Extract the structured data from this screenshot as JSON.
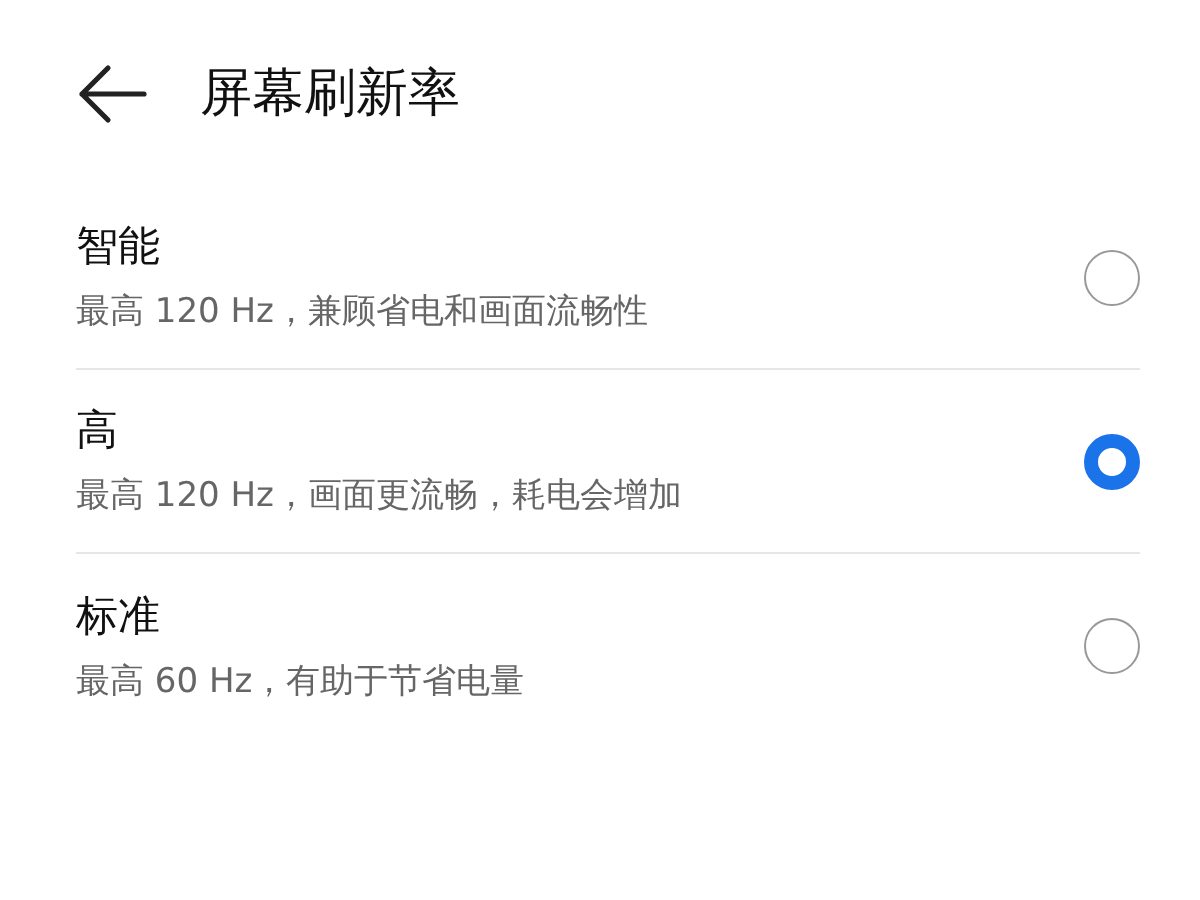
{
  "header": {
    "title": "屏幕刷新率"
  },
  "options": [
    {
      "title": "智能",
      "description": "最高 120 Hz，兼顾省电和画面流畅性",
      "selected": false
    },
    {
      "title": "高",
      "description": "最高 120 Hz，画面更流畅，耗电会增加",
      "selected": true
    },
    {
      "title": "标准",
      "description": "最高 60 Hz，有助于节省电量",
      "selected": false
    }
  ]
}
